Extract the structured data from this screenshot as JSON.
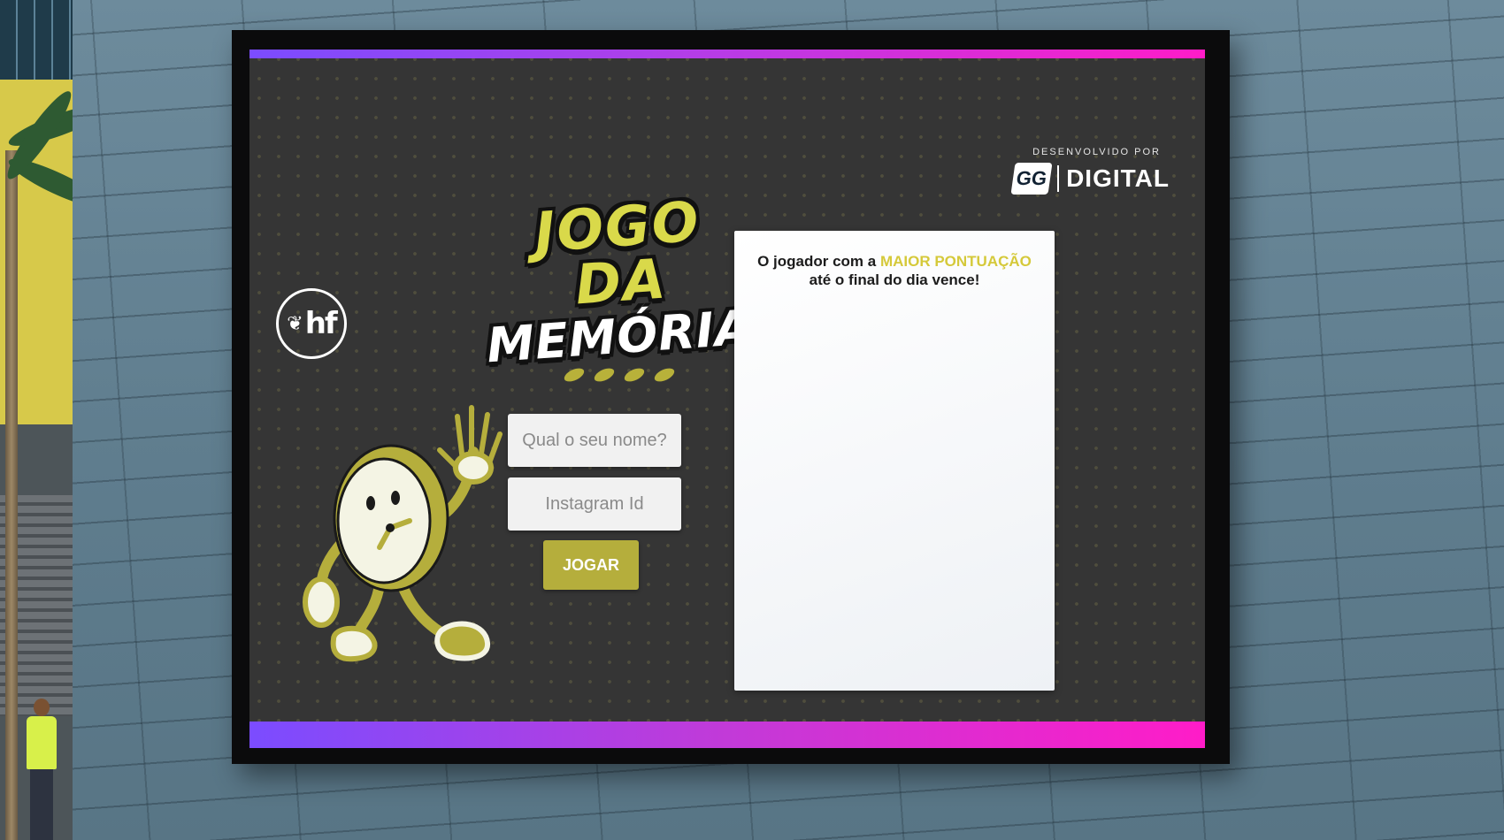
{
  "screen": {
    "credit": {
      "label": "DESENVOLVIDO POR",
      "logo_mark": "GG",
      "brand": "DIGITAL"
    },
    "sponsor_logo": "hf",
    "title": {
      "line1": "JOGO DA",
      "line2": "MEMÓRIA"
    },
    "form": {
      "name_placeholder": "Qual o seu nome?",
      "name_value": "",
      "instagram_placeholder": "Instagram Id",
      "instagram_value": "",
      "play_label": "JOGAR"
    },
    "leaderboard": {
      "msg_prefix": "O jogador com a ",
      "msg_highlight": "MAIOR PONTUAÇÃO",
      "msg_suffix": "até o final do dia vence!"
    },
    "mascot": "clock-mascot-waving"
  },
  "colors": {
    "screen_bg": "#353535",
    "accent_yellow": "#b5ae3c",
    "highlight_yellow": "#d5c93a",
    "gradient_start": "#7b4cff",
    "gradient_end": "#ff1cc8"
  }
}
